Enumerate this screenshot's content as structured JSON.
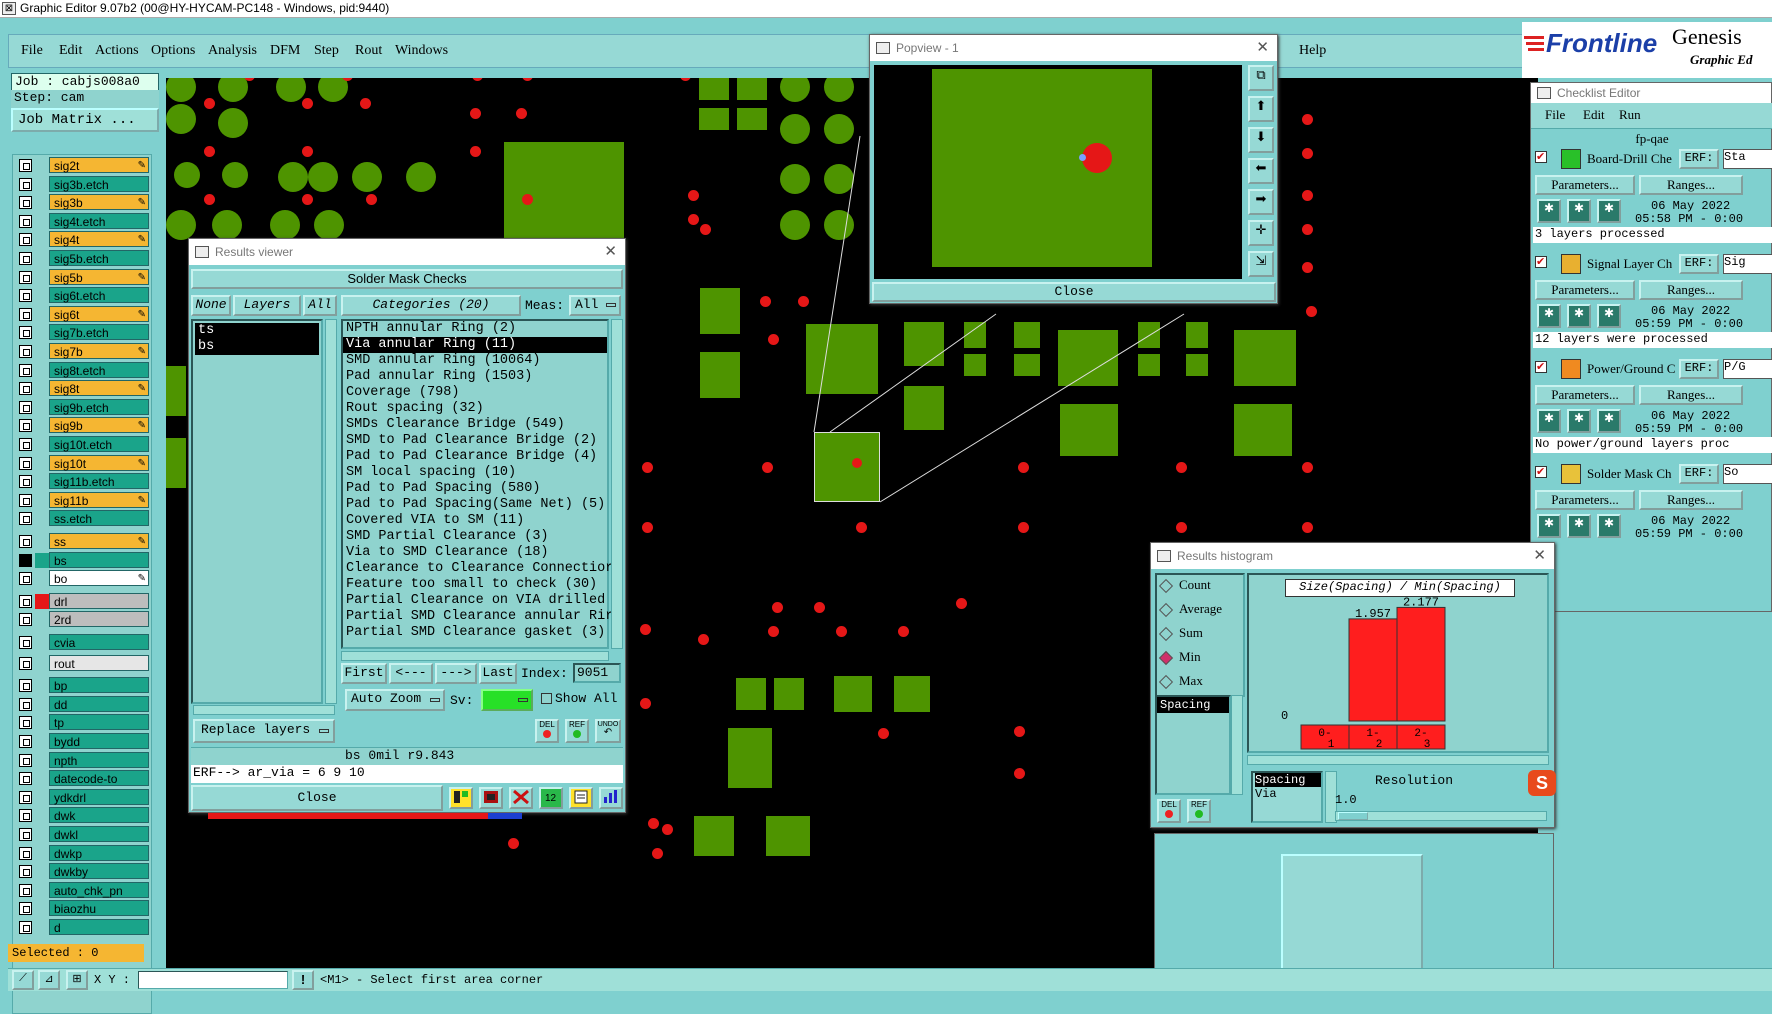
{
  "titlebar": {
    "title": "Graphic Editor 9.07b2 (00@HY-HYCAM-PC148 - Windows, pid:9440)"
  },
  "menu": {
    "items": [
      "File",
      "Edit",
      "Actions",
      "Options",
      "Analysis",
      "DFM",
      "Step",
      "Rout",
      "Windows"
    ],
    "help": "Help"
  },
  "brand": {
    "logo": "Frontline",
    "product": "Genesis",
    "sub": "Graphic Ed"
  },
  "job": {
    "job_label": "Job : cabjs008a0",
    "step_label": "Step: cam",
    "job_matrix": "Job Matrix ..."
  },
  "layers": [
    {
      "name": "sig2t",
      "color": "orange"
    },
    {
      "name": "sig3b.etch",
      "color": "teal"
    },
    {
      "name": "sig3b",
      "color": "orange"
    },
    {
      "name": "sig4t.etch",
      "color": "teal"
    },
    {
      "name": "sig4t",
      "color": "orange"
    },
    {
      "name": "sig5b.etch",
      "color": "teal"
    },
    {
      "name": "sig5b",
      "color": "orange"
    },
    {
      "name": "sig6t.etch",
      "color": "teal"
    },
    {
      "name": "sig6t",
      "color": "orange"
    },
    {
      "name": "sig7b.etch",
      "color": "teal"
    },
    {
      "name": "sig7b",
      "color": "orange"
    },
    {
      "name": "sig8t.etch",
      "color": "teal"
    },
    {
      "name": "sig8t",
      "color": "orange"
    },
    {
      "name": "sig9b.etch",
      "color": "teal"
    },
    {
      "name": "sig9b",
      "color": "orange"
    },
    {
      "name": "sig10t.etch",
      "color": "teal"
    },
    {
      "name": "sig10t",
      "color": "orange"
    },
    {
      "name": "sig11b.etch",
      "color": "teal"
    },
    {
      "name": "sig11b",
      "color": "orange"
    },
    {
      "name": "ss.etch",
      "color": "teal"
    },
    {
      "name": "ss",
      "color": "orange"
    },
    {
      "name": "bs",
      "color": "teal"
    },
    {
      "name": "bo",
      "color": "white"
    },
    {
      "name": "drl",
      "color": "grey"
    },
    {
      "name": "2rd",
      "color": "grey"
    },
    {
      "name": "cvia",
      "color": "teal"
    },
    {
      "name": "rout",
      "color": "light"
    },
    {
      "name": "bp",
      "color": "teal"
    },
    {
      "name": "dd",
      "color": "teal"
    },
    {
      "name": "tp",
      "color": "teal"
    },
    {
      "name": "bydd",
      "color": "teal"
    },
    {
      "name": "npth",
      "color": "teal"
    },
    {
      "name": "datecode-to",
      "color": "teal"
    },
    {
      "name": "ydkdrl",
      "color": "teal"
    },
    {
      "name": "dwk",
      "color": "teal"
    },
    {
      "name": "dwkl",
      "color": "teal"
    },
    {
      "name": "dwkp",
      "color": "teal"
    },
    {
      "name": "dwkby",
      "color": "teal"
    },
    {
      "name": "auto_chk_pn",
      "color": "teal"
    },
    {
      "name": "biaozhu",
      "color": "teal"
    },
    {
      "name": "d",
      "color": "teal"
    }
  ],
  "selected": "Selected : 0",
  "status": {
    "xy_label": "X Y :",
    "prompt": "<M1> - Select first area corner"
  },
  "results_viewer": {
    "title": "Results viewer",
    "header": "Solder Mask Checks",
    "none_btn": "None",
    "layers_btn": "Layers",
    "all_btn": "All",
    "layer_items": [
      "ts",
      "bs"
    ],
    "categories_label": "Categories (20)",
    "meas_label": "Meas:",
    "meas_value": "All",
    "categories": [
      "NPTH annular Ring (2)",
      "Via annular Ring (11)",
      "SMD annular Ring (10064)",
      "Pad annular Ring (1503)",
      "Coverage (798)",
      "Rout spacing (32)",
      "SMDs Clearance Bridge (549)",
      "SMD to Pad Clearance Bridge (2)",
      "Pad to Pad Clearance Bridge (4)",
      "SM local spacing (10)",
      "Pad to Pad Spacing (580)",
      "Pad to Pad Spacing(Same Net) (5)",
      "Covered VIA to SM (11)",
      "SMD Partial Clearance (3)",
      "Via to SMD Clearance (18)",
      "Clearance to Clearance Connectior",
      "Feature too small to check (30)",
      "Partial Clearance on VIA drilled",
      "Partial SMD Clearance annular Rir",
      "Partial SMD Clearance gasket (3)"
    ],
    "selected_category": 1,
    "first": "First",
    "prev": "<---",
    "next": "--->",
    "last": "Last",
    "index_label": "Index:",
    "index_value": "9051",
    "auto_zoom": "Auto Zoom",
    "sv_label": "Sv:",
    "show_all": "Show All",
    "replace_layers": "Replace layers",
    "del": "DEL",
    "ref": "REF",
    "undo": "UNDO",
    "info_line": "bs 0mil   r9.843",
    "erf_line": "ERF--> ar_via = 6 9 10",
    "close": "Close"
  },
  "popview": {
    "title": "Popview - 1",
    "close": "Close"
  },
  "checklist": {
    "title": "Checklist Editor",
    "menu": [
      "File",
      "Edit",
      "Run"
    ],
    "name": "fp-qae",
    "actions": [
      {
        "label": "Board-Drill Che",
        "erf": "ERF:",
        "erf_value": "Sta",
        "date": "06 May 2022",
        "time": "05:58 PM - 0:00",
        "status": "3 layers processed"
      },
      {
        "label": "Signal Layer Ch",
        "erf": "ERF:",
        "erf_value": "Sig",
        "date": "06 May 2022",
        "time": "05:59 PM - 0:00",
        "status": "12 layers were processed"
      },
      {
        "label": "Power/Ground C",
        "erf": "ERF:",
        "erf_value": "P/G",
        "date": "06 May 2022",
        "time": "05:59 PM - 0:00",
        "status": "No power/ground layers proc"
      },
      {
        "label": "Solder Mask Ch",
        "erf": "ERF:",
        "erf_value": "So",
        "date": "06 May 2022",
        "time": "05:59 PM - 0:00",
        "status": ""
      }
    ],
    "params": "Parameters...",
    "ranges": "Ranges..."
  },
  "histogram": {
    "title": "Results histogram",
    "options": [
      "Count",
      "Average",
      "Sum",
      "Min",
      "Max"
    ],
    "selected_option": "Min",
    "list_item": "Spacing",
    "chart_title": "Size(Spacing) / Min(Spacing)",
    "bins": [
      "0-1",
      "1-2",
      "2-3"
    ],
    "bin_values": [
      0,
      1.957,
      2.177
    ],
    "zero_label": "0",
    "spacing_label": "Spacing",
    "via_label": "Via",
    "resolution_label": "Resolution",
    "resolution_value": "1.0",
    "del": "DEL",
    "ref": "REF"
  },
  "colors": {
    "pad": "#4e9400",
    "drill": "#e51717",
    "background": "#000000",
    "panel": "#7fd0cf"
  }
}
